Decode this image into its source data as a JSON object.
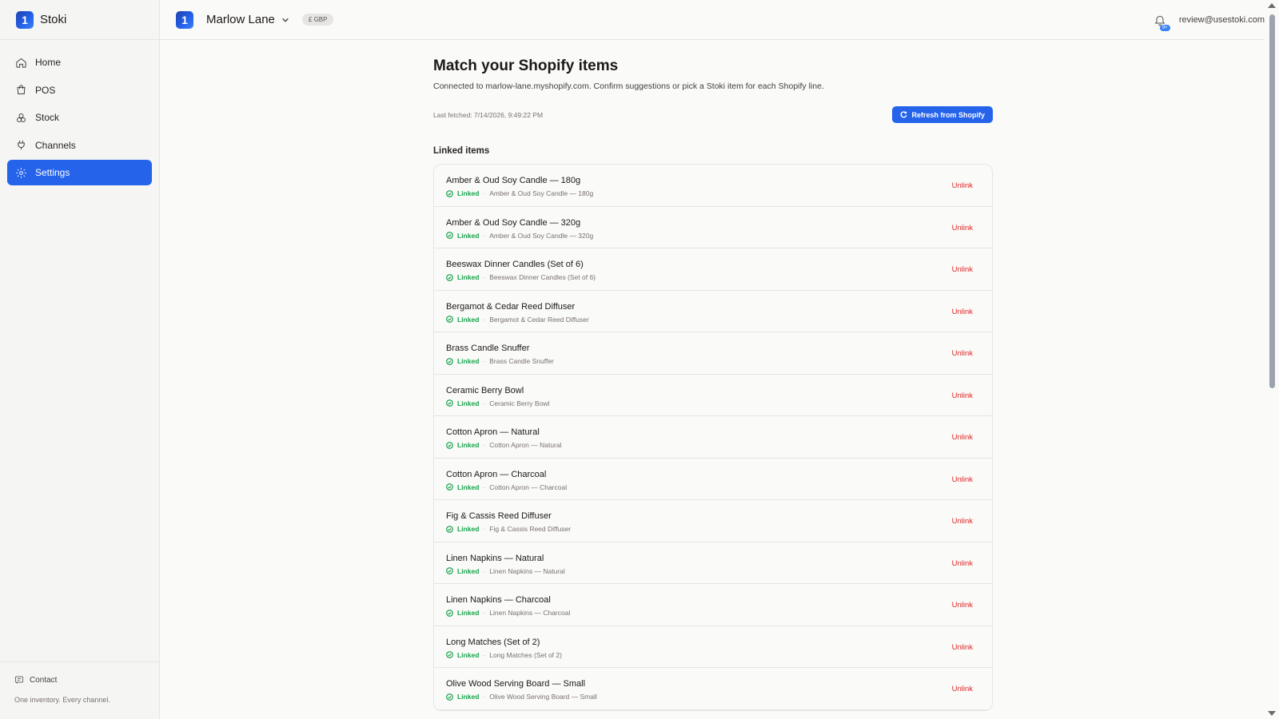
{
  "app": {
    "name": "Stoki",
    "logo_letter": "1",
    "tagline": "One inventory. Every channel."
  },
  "sidebar": {
    "items": [
      {
        "label": "Home",
        "icon": "home-icon"
      },
      {
        "label": "POS",
        "icon": "shopping-bag-icon"
      },
      {
        "label": "Stock",
        "icon": "boxes-icon"
      },
      {
        "label": "Channels",
        "icon": "plug-icon"
      },
      {
        "label": "Settings",
        "icon": "gear-icon",
        "active": true
      }
    ],
    "contact_label": "Contact"
  },
  "topbar": {
    "store_name": "Marlow Lane",
    "currency": "£ GBP",
    "notification_badge": "9+",
    "user_email": "review@usestoki.com"
  },
  "page": {
    "title": "Match your Shopify items",
    "subtitle": "Connected to marlow-lane.myshopify.com. Confirm suggestions or pick a Stoki item for each Shopify line.",
    "last_fetched": "Last fetched: 7/14/2026, 9:49:22 PM",
    "refresh_label": "Refresh from Shopify",
    "section_title": "Linked items"
  },
  "colors": {
    "accent": "#2563eb",
    "linked": "#16a34a",
    "unlink": "#dc2626"
  },
  "linked_items": [
    {
      "title": "Amber & Oud Soy Candle — 180g",
      "status": "Linked",
      "linked_to": "Amber & Oud Soy Candle — 180g",
      "action": "Unlink"
    },
    {
      "title": "Amber & Oud Soy Candle — 320g",
      "status": "Linked",
      "linked_to": "Amber & Oud Soy Candle — 320g",
      "action": "Unlink"
    },
    {
      "title": "Beeswax Dinner Candles (Set of 6)",
      "status": "Linked",
      "linked_to": "Beeswax Dinner Candles (Set of 6)",
      "action": "Unlink"
    },
    {
      "title": "Bergamot & Cedar Reed Diffuser",
      "status": "Linked",
      "linked_to": "Bergamot & Cedar Reed Diffuser",
      "action": "Unlink"
    },
    {
      "title": "Brass Candle Snuffer",
      "status": "Linked",
      "linked_to": "Brass Candle Snuffer",
      "action": "Unlink"
    },
    {
      "title": "Ceramic Berry Bowl",
      "status": "Linked",
      "linked_to": "Ceramic Berry Bowl",
      "action": "Unlink"
    },
    {
      "title": "Cotton Apron — Natural",
      "status": "Linked",
      "linked_to": "Cotton Apron — Natural",
      "action": "Unlink"
    },
    {
      "title": "Cotton Apron — Charcoal",
      "status": "Linked",
      "linked_to": "Cotton Apron — Charcoal",
      "action": "Unlink"
    },
    {
      "title": "Fig & Cassis Reed Diffuser",
      "status": "Linked",
      "linked_to": "Fig & Cassis Reed Diffuser",
      "action": "Unlink"
    },
    {
      "title": "Linen Napkins — Natural",
      "status": "Linked",
      "linked_to": "Linen Napkins — Natural",
      "action": "Unlink"
    },
    {
      "title": "Linen Napkins — Charcoal",
      "status": "Linked",
      "linked_to": "Linen Napkins — Charcoal",
      "action": "Unlink"
    },
    {
      "title": "Long Matches (Set of 2)",
      "status": "Linked",
      "linked_to": "Long Matches (Set of 2)",
      "action": "Unlink"
    },
    {
      "title": "Olive Wood Serving Board — Small",
      "status": "Linked",
      "linked_to": "Olive Wood Serving Board — Small",
      "action": "Unlink"
    }
  ]
}
